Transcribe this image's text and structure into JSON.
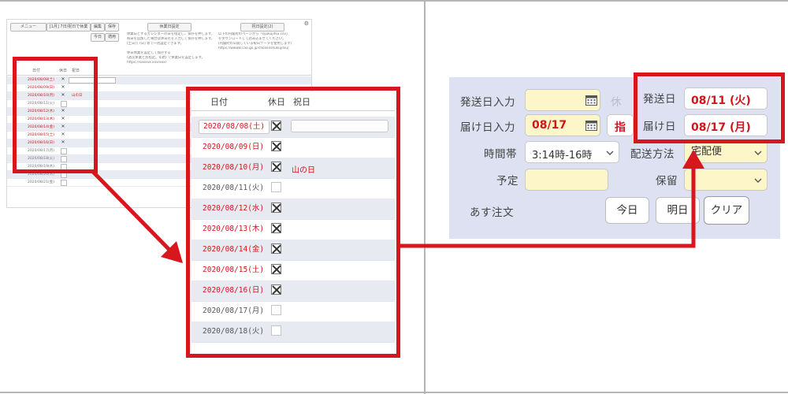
{
  "mini": {
    "menu_button": "メニュー",
    "pick_button": "[1月] 7日/祝日で休業",
    "edit_button": "編集",
    "save_button": "保存",
    "today_button": "今日",
    "reset_button": "適用",
    "setting_button_1": "休業日設定",
    "setting_button_2": "祝日設定(2)",
    "note1_lines": [
      "休業日とするカレンダーの日を指定し、保存を押します。",
      "祝日を追加した場合は休日名を入力して保存を押します。",
      "[土日] [7日] 等で一括設定できます。",
      "",
      "休日休業を設定して保存する",
      "(週次休業と別指定。年始) で休業日を設定します。",
      "https://xxxxxx.xxx/xxx/"
    ],
    "note2_lines": [
      "以下の内閣府のページから「syukujitsu.csv」",
      "をダウンロードして読み込ませてください。",
      "(内閣府の公開している祝日データを使用します)",
      "https://www8.cao.go.jp/chosei/shukujitsu/"
    ],
    "header": {
      "date": "日付",
      "holiday": "休日",
      "holiday_name": "祝日"
    },
    "rows": [
      {
        "date": "2020/08/08(土)",
        "red": true,
        "checked": true,
        "input": true,
        "holiday_name": ""
      },
      {
        "date": "2020/08/09(日)",
        "red": true,
        "checked": true,
        "input": false,
        "holiday_name": ""
      },
      {
        "date": "2020/08/10(月)",
        "red": true,
        "checked": true,
        "input": false,
        "holiday_name": "山の日"
      },
      {
        "date": "2020/08/11(火)",
        "red": false,
        "checked": false,
        "input": false,
        "holiday_name": ""
      },
      {
        "date": "2020/08/12(水)",
        "red": true,
        "checked": true,
        "input": false,
        "holiday_name": ""
      },
      {
        "date": "2020/08/13(木)",
        "red": true,
        "checked": true,
        "input": false,
        "holiday_name": ""
      },
      {
        "date": "2020/08/14(金)",
        "red": true,
        "checked": true,
        "input": false,
        "holiday_name": ""
      },
      {
        "date": "2020/08/15(土)",
        "red": true,
        "checked": true,
        "input": false,
        "holiday_name": ""
      },
      {
        "date": "2020/08/16(日)",
        "red": true,
        "checked": true,
        "input": false,
        "holiday_name": ""
      },
      {
        "date": "2020/08/17(月)",
        "red": false,
        "checked": false,
        "input": false,
        "holiday_name": ""
      },
      {
        "date": "2020/08/18(火)",
        "red": false,
        "checked": false,
        "input": false,
        "holiday_name": ""
      },
      {
        "date": "2020/08/19(水)",
        "red": false,
        "checked": false,
        "input": false,
        "holiday_name": ""
      },
      {
        "date": "2020/08/20(木)",
        "red": false,
        "checked": false,
        "input": false,
        "holiday_name": ""
      },
      {
        "date": "2020/08/21(金)",
        "red": false,
        "checked": false,
        "input": false,
        "holiday_name": ""
      }
    ]
  },
  "zoom": {
    "header": {
      "date": "日付",
      "holiday": "休日",
      "holiday_name": "祝日"
    },
    "rows": [
      {
        "date": "2020/08/08(土)",
        "red": true,
        "checked": true,
        "input": true,
        "holiday_name": ""
      },
      {
        "date": "2020/08/09(日)",
        "red": true,
        "checked": true,
        "input": false,
        "holiday_name": ""
      },
      {
        "date": "2020/08/10(月)",
        "red": true,
        "checked": true,
        "input": false,
        "holiday_name": "山の日"
      },
      {
        "date": "2020/08/11(火)",
        "red": false,
        "checked": false,
        "input": false,
        "holiday_name": ""
      },
      {
        "date": "2020/08/12(水)",
        "red": true,
        "checked": true,
        "input": false,
        "holiday_name": ""
      },
      {
        "date": "2020/08/13(木)",
        "red": true,
        "checked": true,
        "input": false,
        "holiday_name": ""
      },
      {
        "date": "2020/08/14(金)",
        "red": true,
        "checked": true,
        "input": false,
        "holiday_name": ""
      },
      {
        "date": "2020/08/15(土)",
        "red": true,
        "checked": true,
        "input": false,
        "holiday_name": ""
      },
      {
        "date": "2020/08/16(日)",
        "red": true,
        "checked": true,
        "input": false,
        "holiday_name": ""
      },
      {
        "date": "2020/08/17(月)",
        "red": false,
        "checked": false,
        "input": false,
        "holiday_name": ""
      },
      {
        "date": "2020/08/18(火)",
        "red": false,
        "checked": false,
        "input": false,
        "holiday_name": ""
      }
    ]
  },
  "form": {
    "ship_input_label": "発送日入力",
    "ship_input_value": "",
    "ship_partial": "休",
    "deliver_input_label": "届け日入力",
    "deliver_input_value": "08/17",
    "designate_label": "指",
    "ship_day_label": "発送日",
    "ship_day_value": "08/11 (火)",
    "deliver_day_label": "届け日",
    "deliver_day_value": "08/17 (月)",
    "time_label": "時間帯",
    "time_value": "3:14時-16時",
    "method_label": "配送方法",
    "method_value": "宅配便",
    "schedule_label": "予定",
    "hold_label": "保留",
    "tomorrow_order_label": "あす注文",
    "today_button": "今日",
    "tomorrow_button": "明日",
    "clear_button": "クリア"
  },
  "colors": {
    "accent_red": "#d7161d",
    "form_bg": "#dde1f2",
    "field_yellow": "#fdf6c8",
    "row_shade": "#e8eaf1"
  }
}
